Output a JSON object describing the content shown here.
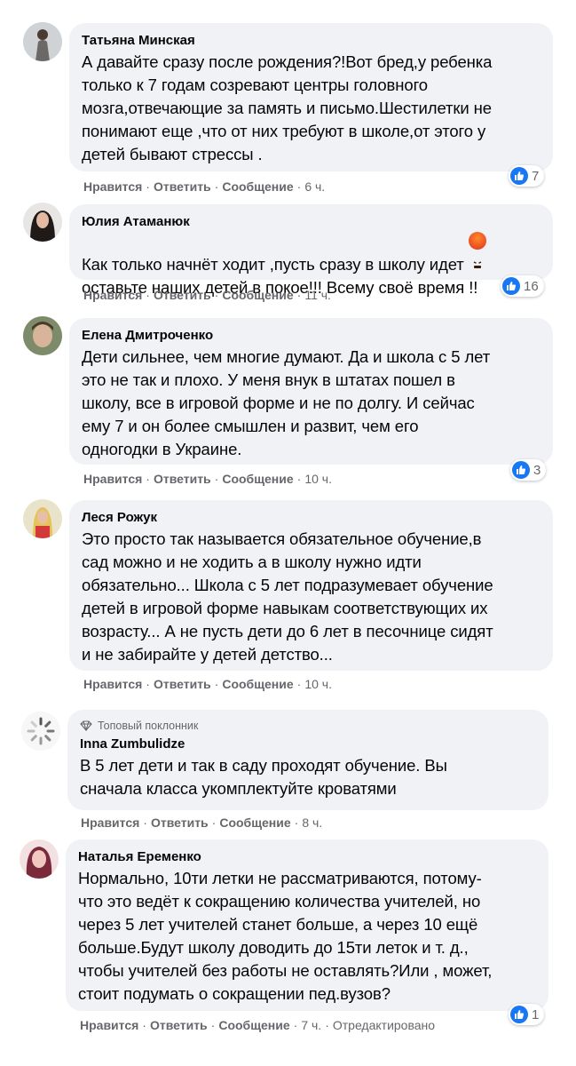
{
  "actions": {
    "like": "Нравится",
    "reply": "Ответить",
    "message": "Сообщение",
    "edited": "Отредактировано"
  },
  "comments": [
    {
      "author": "Татьяна Минская",
      "text": "А давайте сразу после рождения?!Вот бред,у ребенка\nтолько к 7 годам созревают центры головного\nмозга,отвечающие за память и письмо.Шестилетки не\nпонимают еще ,что от них требуют в школе,от этого у\nдетей бывают стрессы .",
      "time": "6 ч.",
      "reactions": "7",
      "avatar_color": "#8d8a86"
    },
    {
      "author": "Юлия Атаманюк",
      "text": "Как только начнёт ходит ,пусть сразу в школу идет",
      "text2": "оставьте наших детей в покое!!! Всему своё время !!",
      "emoji": "angry-face-emoji",
      "time": "11 ч.",
      "reactions": "16",
      "avatar_color": "#3b2f2a"
    },
    {
      "author": "Елена Дмитроченко",
      "text": "Дети сильнее, чем многие думают. Да и школа с 5 лет\nэто не так и плохо. У меня внук в штатах пошел в\nшколу, все в игровой форме и не по долгу. И сейчас\nему 7 и он более смышлен и развит, чем его\nодногодки в Украине.",
      "time": "10 ч.",
      "reactions": "3",
      "avatar_color": "#6b7a5a"
    },
    {
      "author": "Леся Рожук",
      "text": "Это просто так называется обязательное обучение,в\nсад можно и не ходить а в школу нужно идти\nобязательно... Школа с 5 лет подразумевает обучение\nдетей в игровой форме навыкам соответствующих их\nвозрасту... А не пусть дети до 6 лет в песочнице сидят\nи не забирайте у детей детство...",
      "time": "10 ч."
    },
    {
      "badge": "Топовый поклонник",
      "author": "Inna Zumbulidze",
      "text": "В 5 лет дети и так в саду проходят обучение. Вы\nсначала класса укомплектуйте кроватями",
      "time": "8 ч."
    },
    {
      "author": "Наталья Еременко",
      "text": "Нормально, 10ти летки не рассматриваются, потому-\nчто это ведёт к сокращению количества учителей, но\nчерез 5 лет учителей станет больше, а через 10 ещё\nбольше.Будут школу доводить до 15ти леток и т. д.,\nчтобы учителей без работы не оставлять?Или , может,\nстоит подумать о сокращении пед.вузов?",
      "time": "7 ч.",
      "reactions": "1"
    }
  ]
}
